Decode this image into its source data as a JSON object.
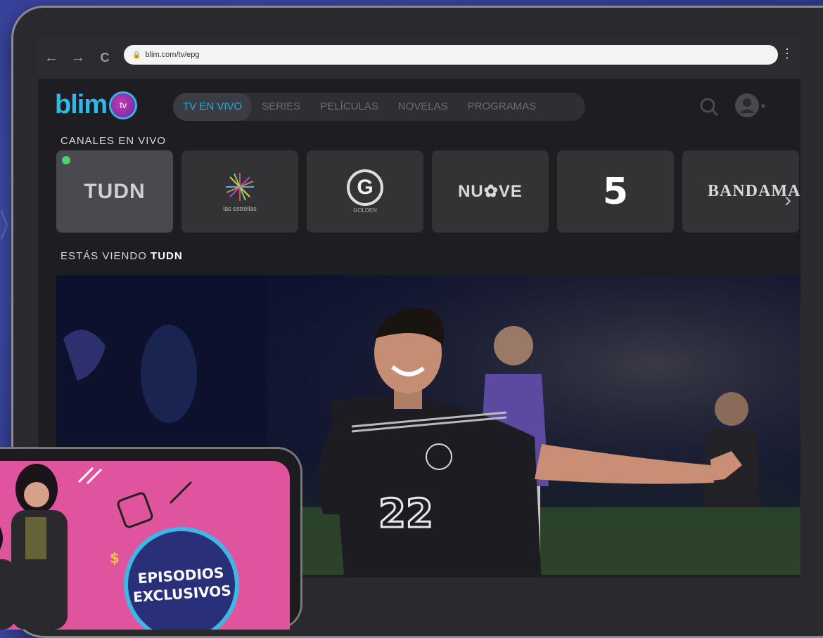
{
  "browser": {
    "url": "blim.com/tv/epg",
    "back_glyph": "←",
    "forward_glyph": "→",
    "reload_glyph": "C",
    "lock_glyph": "🔒",
    "menu_glyph": "⋮"
  },
  "app": {
    "logo_text": "blim",
    "logo_badge": "tv",
    "nav": [
      {
        "label": "TV EN VIVO",
        "active": true
      },
      {
        "label": "SERIES",
        "active": false
      },
      {
        "label": "PELÍCULAS",
        "active": false
      },
      {
        "label": "NOVELAS",
        "active": false
      },
      {
        "label": "PROGRAMAS",
        "active": false
      }
    ],
    "icons": {
      "search": "search-icon",
      "user": "user-avatar-icon",
      "dropdown": "chevron-down-icon"
    }
  },
  "channels_section": {
    "title": "CANALES EN VIVO",
    "channels": [
      {
        "name": "TUDN",
        "live": true
      },
      {
        "name": "LAS ESTRELLAS",
        "sub": "las estrellas"
      },
      {
        "name": "GOLDEN",
        "glyph": "G",
        "sub": "GOLDEN"
      },
      {
        "name": "NU9VE",
        "text": "NU✿VE"
      },
      {
        "name": "5",
        "text": "5"
      },
      {
        "name": "BANDAMAX",
        "text": "BANDAMAX"
      }
    ],
    "next_arrow": "›"
  },
  "now_watching": {
    "prefix": "ESTÁS VIENDO ",
    "channel": "TUDN",
    "jersey_number": "22"
  },
  "promo": {
    "line1": "EPISODIOS",
    "line2": "EXCLUSIVOS",
    "colors": {
      "bg": "#e0549e",
      "badge": "#2a2f7a",
      "ring": "#3fb7e6"
    }
  },
  "colors": {
    "accent": "#2fb8e8",
    "live": "#49d36a",
    "background": "#3a45a0"
  }
}
